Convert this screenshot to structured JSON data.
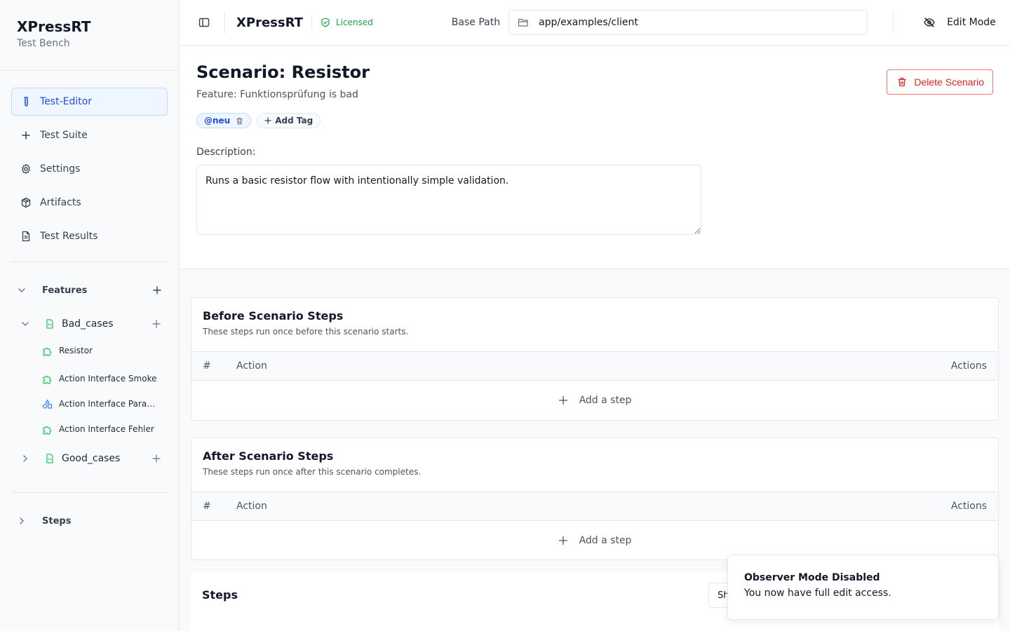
{
  "brand": {
    "title": "XPressRT",
    "subtitle": "Test Bench"
  },
  "nav": [
    {
      "label": "Test-Editor",
      "icon": "test-tube-icon",
      "active": true
    },
    {
      "label": "Test Suite",
      "icon": "plus-icon"
    },
    {
      "label": "Settings",
      "icon": "gear-icon"
    },
    {
      "label": "Artifacts",
      "icon": "package-icon"
    },
    {
      "label": "Test Results",
      "icon": "document-icon"
    }
  ],
  "features": {
    "label": "Features",
    "folders": [
      {
        "label": "Bad_cases",
        "expanded": true,
        "items": [
          {
            "label": "Resistor",
            "icon": "puzzle-icon"
          },
          {
            "label": "Action Interface Smoke",
            "icon": "puzzle-icon"
          },
          {
            "label": "Action Interface Parameters",
            "icon": "shapes-icon"
          },
          {
            "label": "Action Interface Fehler",
            "icon": "puzzle-icon"
          }
        ]
      },
      {
        "label": "Good_cases",
        "expanded": false
      }
    ]
  },
  "steps_section": {
    "label": "Steps"
  },
  "header": {
    "title": "XPressRT",
    "license": "Licensed",
    "base_path_label": "Base Path",
    "base_path_value": "app/examples/client",
    "edit_mode": "Edit Mode"
  },
  "scenario": {
    "title": "Scenario: Resistor",
    "feature": "Feature: Funktionsprüfung is bad",
    "tags": [
      "@neu"
    ],
    "add_tag": "Add Tag",
    "description_label": "Description:",
    "description": "Runs a basic resistor flow with intentionally simple validation.",
    "delete": "Delete Scenario"
  },
  "before": {
    "title": "Before Scenario Steps",
    "subtitle": "These steps run once before this scenario starts.",
    "col_num": "#",
    "col_action": "Action",
    "col_actions": "Actions",
    "add": "Add a step"
  },
  "after": {
    "title": "After Scenario Steps",
    "subtitle": "These steps run once after this scenario completes.",
    "col_num": "#",
    "col_action": "Action",
    "col_actions": "Actions",
    "add": "Add a step"
  },
  "steps": {
    "title": "Steps",
    "button": "Sh"
  },
  "toast": {
    "title": "Observer Mode Disabled",
    "message": "You now have full edit access."
  },
  "colors": {
    "accent": "#1d4ed8",
    "success": "#16a34a",
    "danger": "#dc2626",
    "feature_icon": "#22c55e",
    "leaf_alt": "#3b82f6"
  }
}
